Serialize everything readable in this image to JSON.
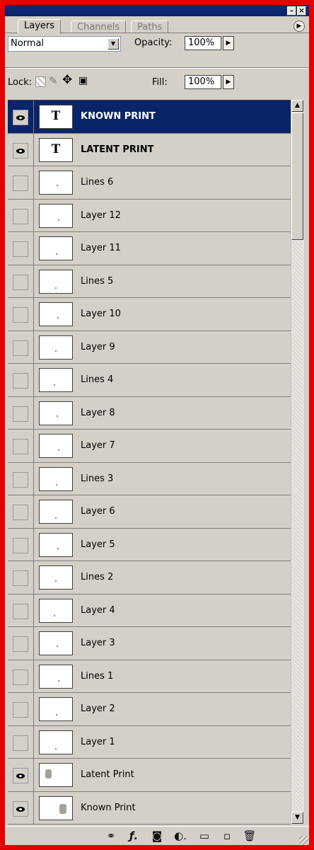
{
  "tabs": [
    "Layers",
    "Channels",
    "Paths"
  ],
  "blend_mode": "Normal",
  "opacity_label": "Opacity:",
  "opacity_value": "100%",
  "lock_label": "Lock:",
  "fill_label": "Fill:",
  "fill_value": "100%",
  "layers": [
    {
      "name": "KNOWN PRINT",
      "type": "text",
      "visible": true,
      "selected": true
    },
    {
      "name": "LATENT PRINT",
      "type": "text",
      "visible": true,
      "selected": false
    },
    {
      "name": "Lines 6",
      "type": "raster",
      "visible": false,
      "selected": false
    },
    {
      "name": "Layer 12",
      "type": "raster",
      "visible": false,
      "selected": false
    },
    {
      "name": "Layer 11",
      "type": "raster",
      "visible": false,
      "selected": false
    },
    {
      "name": "Lines 5",
      "type": "raster",
      "visible": false,
      "selected": false
    },
    {
      "name": "Layer 10",
      "type": "raster",
      "visible": false,
      "selected": false
    },
    {
      "name": "Layer 9",
      "type": "raster",
      "visible": false,
      "selected": false
    },
    {
      "name": "Lines 4",
      "type": "raster",
      "visible": false,
      "selected": false
    },
    {
      "name": "Layer 8",
      "type": "raster",
      "visible": false,
      "selected": false
    },
    {
      "name": "Layer 7",
      "type": "raster",
      "visible": false,
      "selected": false
    },
    {
      "name": "Lines 3",
      "type": "raster",
      "visible": false,
      "selected": false
    },
    {
      "name": "Layer 6",
      "type": "raster",
      "visible": false,
      "selected": false
    },
    {
      "name": "Layer 5",
      "type": "raster",
      "visible": false,
      "selected": false
    },
    {
      "name": "Lines 2",
      "type": "raster",
      "visible": false,
      "selected": false
    },
    {
      "name": "Layer 4",
      "type": "raster",
      "visible": false,
      "selected": false
    },
    {
      "name": "Layer 3",
      "type": "raster",
      "visible": false,
      "selected": false
    },
    {
      "name": "Lines 1",
      "type": "raster",
      "visible": false,
      "selected": false
    },
    {
      "name": "Layer 2",
      "type": "raster",
      "visible": false,
      "selected": false
    },
    {
      "name": "Layer 1",
      "type": "raster",
      "visible": false,
      "selected": false
    },
    {
      "name": "Latent Print",
      "type": "image",
      "visible": true,
      "selected": false
    },
    {
      "name": "Known Print",
      "type": "image",
      "visible": true,
      "selected": false
    }
  ],
  "bottom_icons": [
    "link-icon",
    "layer-style-icon",
    "layer-mask-icon",
    "adjustment-layer-icon",
    "new-group-icon",
    "new-layer-icon",
    "trash-icon"
  ],
  "colors": {
    "selection": "#0a246a",
    "panel": "#d4d0c8",
    "border": "#e40000"
  }
}
